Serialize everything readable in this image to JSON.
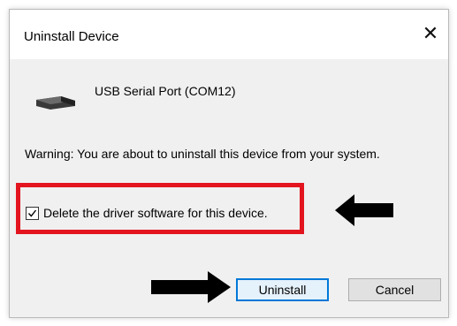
{
  "dialog": {
    "title": "Uninstall Device",
    "close_icon": "close-icon"
  },
  "device": {
    "icon": "usb-serial-port-icon",
    "name": "USB Serial Port (COM12)"
  },
  "warning_text": "Warning: You are about to uninstall this device from your system.",
  "delete_driver": {
    "label": "Delete the driver software for this device.",
    "checked": true
  },
  "buttons": {
    "uninstall": "Uninstall",
    "cancel": "Cancel"
  },
  "annotations": {
    "highlight_color": "#e3141e",
    "arrow_color": "#000000",
    "arrow_icons": [
      "arrow-left-icon",
      "arrow-right-icon"
    ]
  },
  "colors": {
    "accent": "#0078d7",
    "dialog_bg": "#f0f0f0",
    "titlebar_bg": "#ffffff"
  }
}
